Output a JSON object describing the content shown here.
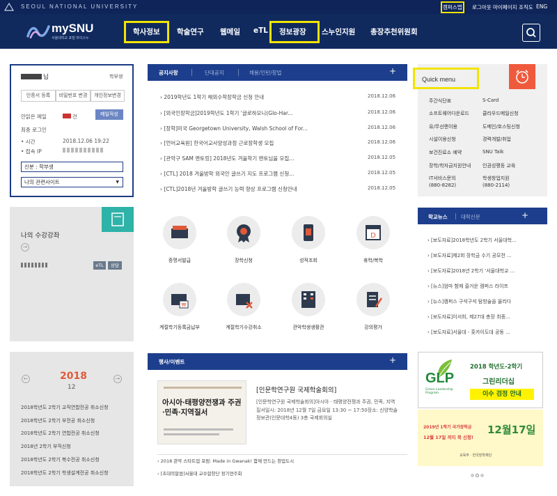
{
  "top": {
    "univ_name": "SEOUL NATIONAL UNIVERSITY",
    "links": [
      "캠퍼스맵",
      "로그아웃",
      "마이페이지",
      "조직도",
      "ENG"
    ]
  },
  "header": {
    "logo_text": "mySNU",
    "logo_sub": "서울대학교 포털 마이스누",
    "nav": [
      "학사정보",
      "학술연구",
      "웹메일",
      "eTL",
      "정보광장",
      "스누인지원",
      "총장추천위원회"
    ]
  },
  "profile": {
    "name_suffix": "님",
    "role": "학부생",
    "buttons": [
      "인증서 등록",
      "비밀번호 변경",
      "개인정보변경"
    ],
    "unread_label": "안읽은 메일",
    "unread_count": "건",
    "mail_button": "메일작성",
    "last_login": "최종 로그인",
    "time_label": "• 시간",
    "time_value": "2018.12.06 19:22",
    "ip_label": "• 접속 IP",
    "status": "신분 : 학부생",
    "related_sites": "나의 관련사이트"
  },
  "lecture": {
    "title": "나의 수강강좌",
    "tags": [
      "eTL",
      "상담"
    ]
  },
  "calendar": {
    "year": "2018",
    "month": "12",
    "items": [
      "2018학년도 2학기 교직연합전공 취소신청",
      "2018학년도 2학기 부전공 취소신청",
      "2018학년도 2학기 연합전공 취소신청",
      "2018년 2학기 부직신청",
      "2018학년도 2학기 복수전공 취소신청",
      "2018학년도 2학기 학생설계전공 취소신청"
    ]
  },
  "notice": {
    "tabs": [
      "공지사항",
      "단대공지",
      "채용/인턴/창업"
    ],
    "more": "+",
    "items": [
      {
        "title": "2019학년도 1학기 해외수학장학금 신청 안내",
        "date": "2018.12.06"
      },
      {
        "title": "[외국인장학금]2019학년도 1학기 '글로하모니(Glo-Har...",
        "date": "2018.12.06"
      },
      {
        "title": "[장학]미국 Georgetown University, Walsh School of For...",
        "date": "2018.12.06"
      },
      {
        "title": "[언어교육원] 한국어교사양성과정 근로장학생 모집",
        "date": "2018.12.06"
      },
      {
        "title": "[관악구 SAM 멘토링] 2018년도 겨울학기 멘토님을 모집...",
        "date": "2018.12.05"
      },
      {
        "title": "[CTL] 2018 겨울방학 외국인 글쓰기 지도 프로그램 신청...",
        "date": "2018.12.05"
      },
      {
        "title": "[CTL]2018년 겨울방학 글쓰기 능력 향상 프로그램 신청안내",
        "date": "2018.12.05"
      }
    ]
  },
  "services": [
    {
      "label": "증명서발급",
      "icon": "certificate-icon"
    },
    {
      "label": "장학신청",
      "icon": "scholarship-icon"
    },
    {
      "label": "성적조회",
      "icon": "grades-icon"
    },
    {
      "label": "휴학/복학",
      "icon": "leave-icon"
    },
    {
      "label": "계절학기등록금납부",
      "icon": "tuition-icon"
    },
    {
      "label": "계절학기수강취소",
      "icon": "course-cancel-icon"
    },
    {
      "label": "관악학생생활관",
      "icon": "dormitory-icon"
    },
    {
      "label": "강의평가",
      "icon": "evaluation-icon"
    }
  ],
  "event": {
    "tab": "행사/이벤트",
    "more": "+",
    "poster_title": "아시아·태평양전쟁과 주권·민족·지역질서",
    "headline": "[인문학연구원 국제학술회의]",
    "desc": "[인문학연구원 국제학술회의]아시아 · 태평양전쟁과 주권, 민족, 지역질서일시: 2018년 12월 7일 금요일 13:30 ~ 17:50장소: 신양학술정보관(인문대학4동) 3층 국제회의실",
    "links": [
      "2018 관악 스타트업 포럼: Made in Gwanak! 함께 만드는 창업도시",
      "[초대의말씀]서울대 교수합창단 정기연주회"
    ]
  },
  "quick": {
    "title": "Quick menu",
    "items": [
      [
        "주간식단표",
        "S-Card"
      ],
      [
        "소프트웨어다운로드",
        "클라우드메일신청"
      ],
      [
        "유/무선랜이용",
        "도메인/호스팅신청"
      ],
      [
        "시설이용신청",
        "경력개발/취업"
      ],
      [
        "보건진료소 예약",
        "SNU Talk"
      ],
      [
        "장학/학자금지원안내",
        "인권성평등 교육"
      ],
      [
        "IT서비스문의\n(880-8282)",
        "학생창업지원\n(880-2114)"
      ]
    ]
  },
  "news": {
    "tabs": [
      "학교뉴스",
      "대학신문"
    ],
    "more": "+",
    "items": [
      "[보도자료]2018학년도 2학기 서울대학...",
      "[보도자료]제2회 장학금 수기 공모전 ...",
      "[보도자료]2018년 2학기 '서울대학교 ...",
      "[뉴스]엄마 함께 즐거운 캠퍼스 라이프",
      "[뉴스]캠퍼스 구석구석 탐방술을 올리다",
      "[보도자료]이서희, 제27대 총장 최종...",
      "[보도자료]서울대 - 홋카이도대 공동 ..."
    ]
  },
  "banners": {
    "glp_logo": "GLP",
    "glp_logo_sub": "Green Leadership Program",
    "glp_line1": "2018 학년도-2학기",
    "glp_line2": "그린리더십",
    "glp_line3": "이수 검정 안내",
    "scholar_line1": "2019년 1학기 국가장학금",
    "scholar_line2": "12월 17일 까지 꼭 신청!",
    "scholar_big": "12월17일",
    "scholar_org": "교육부 · 한국장학재단"
  },
  "colors": {
    "navy": "#102a5e",
    "panel_blue": "#1c3e8c",
    "highlight": "#f2e400",
    "quick_orange": "#f05a3c",
    "lecture_teal": "#2fb3a8"
  }
}
